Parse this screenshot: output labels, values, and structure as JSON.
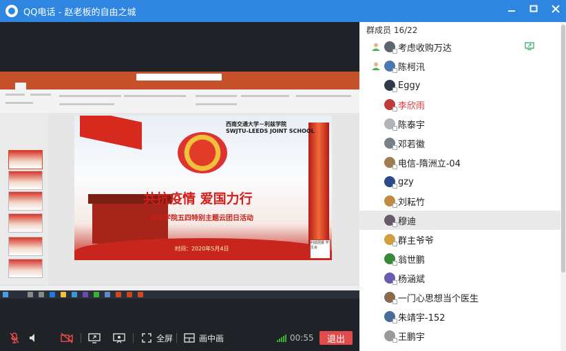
{
  "window": {
    "app_name": "QQ电话",
    "separator": " - ",
    "group_name": "赵老板的自由之城",
    "controls": [
      "minimize-icon",
      "maximize-icon",
      "close-icon"
    ]
  },
  "shared_screen": {
    "slide": {
      "school_cn": "西南交通大学－利兹学院",
      "school_en": "SWJTU-LEEDS JOINT SCHOOL",
      "headline": "共抗疫情  爱国力行",
      "subtitle": "利兹学院五四特别主题云团日活动",
      "date_line": "时间：2020年5月4日",
      "corner_badge": "利兹团委 学生会"
    }
  },
  "toolbar": {
    "mic_icon": "mic-muted-icon",
    "speaker_icon": "speaker-icon",
    "camera_icon": "camera-off-icon",
    "screen_share_icon": "screen-share-icon",
    "presenter_icon": "presenter-icon",
    "fullscreen_icon": "fullscreen-icon",
    "fullscreen_label": "全屏",
    "pip_icon": "picture-in-picture-icon",
    "pip_label": "画中画",
    "signal_icon": "signal-strength-icon",
    "timer": "00:55",
    "exit_label": "退出",
    "exit_color": "#e04b4b"
  },
  "members": {
    "header": "群成员 16/22",
    "list": [
      {
        "name": "考虑收购万达",
        "speaking": true,
        "sharing": true,
        "avatar": "#5b6470"
      },
      {
        "name": "陈柯汛",
        "speaking": true,
        "sharing": false,
        "avatar": "#4a77b0"
      },
      {
        "name": "Eggy",
        "speaking": false,
        "sharing": false,
        "avatar": "#2d3a4a"
      },
      {
        "name": "李欣雨",
        "speaking": false,
        "sharing": false,
        "avatar": "#c23a3a",
        "highlight": true
      },
      {
        "name": "陈泰宇",
        "speaking": false,
        "sharing": false,
        "avatar": "#b0b4b8"
      },
      {
        "name": "邓若徽",
        "speaking": false,
        "sharing": false,
        "avatar": "#7a7f86"
      },
      {
        "name": "电信-隋洲立-04",
        "speaking": false,
        "sharing": false,
        "avatar": "#a07a50"
      },
      {
        "name": "gzy",
        "speaking": false,
        "sharing": false,
        "avatar": "#2a4a8a"
      },
      {
        "name": "刘耘竹",
        "speaking": false,
        "sharing": false,
        "avatar": "#c08a40"
      },
      {
        "name": "穆迪",
        "speaking": false,
        "sharing": false,
        "avatar": "#6a5a6a",
        "hovered": true
      },
      {
        "name": "群主爷爷",
        "speaking": false,
        "sharing": false,
        "avatar": "#d0a040"
      },
      {
        "name": "翁世鹏",
        "speaking": false,
        "sharing": false,
        "avatar": "#3a8a3a"
      },
      {
        "name": "杨涵斌",
        "speaking": false,
        "sharing": false,
        "avatar": "#6a5ab0"
      },
      {
        "name": "一门心思想当个医生",
        "speaking": false,
        "sharing": false,
        "avatar": "#8a6a4a"
      },
      {
        "name": "朱靖宇-152",
        "speaking": false,
        "sharing": false,
        "avatar": "#4a6a9a"
      },
      {
        "name": "王鹏宇",
        "speaking": false,
        "sharing": false,
        "avatar": "#9a9a9a"
      }
    ]
  },
  "colors": {
    "titlebar": "#2f86e0",
    "speaking": "#4caf50",
    "share": "#3cb371"
  }
}
